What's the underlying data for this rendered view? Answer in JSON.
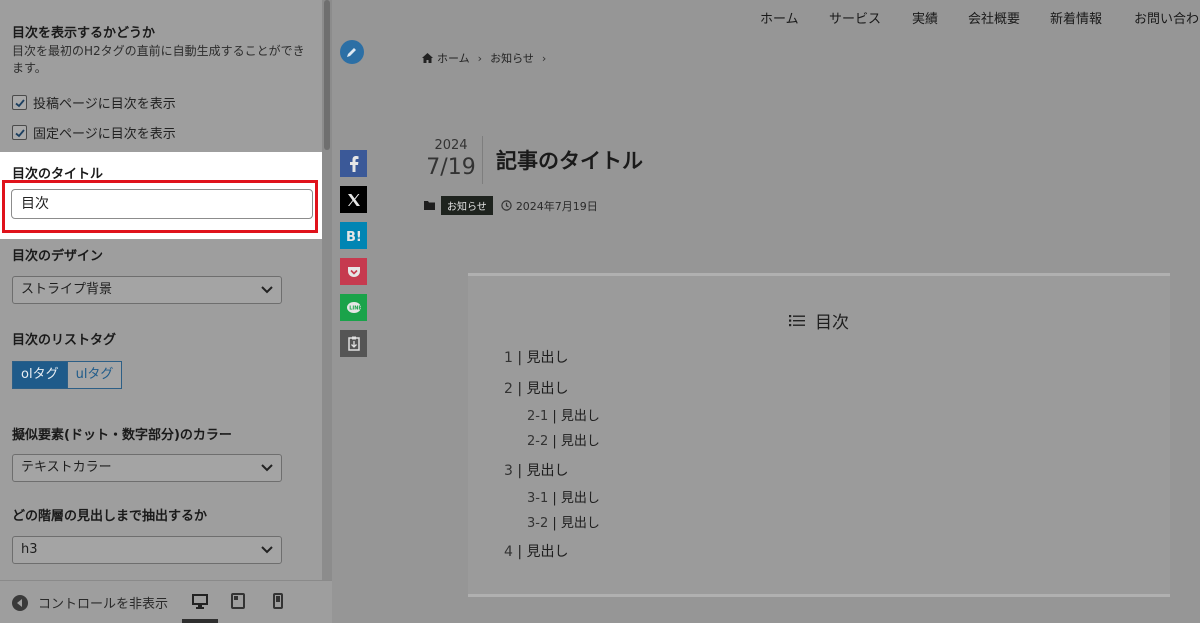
{
  "panel": {
    "toc_display": {
      "title": "目次を表示するかどうか",
      "description": "目次を最初のH2タグの直前に自動生成することができます。",
      "options": [
        {
          "label": "投稿ページに目次を表示",
          "checked": true
        },
        {
          "label": "固定ページに目次を表示",
          "checked": true
        }
      ]
    },
    "toc_title": {
      "label": "目次のタイトル",
      "value": "目次"
    },
    "toc_design": {
      "label": "目次のデザイン",
      "selected": "ストライプ背景"
    },
    "toc_list_tag": {
      "label": "目次のリストタグ",
      "options": [
        "olタグ",
        "ulタグ"
      ],
      "active": "olタグ"
    },
    "pseudo_color": {
      "label": "擬似要素(ドット・数字部分)のカラー",
      "selected": "テキストカラー"
    },
    "heading_depth": {
      "label": "どの階層の見出しまで抽出するか",
      "selected": "h3"
    },
    "footer": {
      "hide_controls": "コントロールを非表示"
    }
  },
  "preview": {
    "nav": [
      "ホーム",
      "サービス",
      "実績",
      "会社概要",
      "新着情報",
      "お問い合わ"
    ],
    "breadcrumb": [
      "ホーム",
      "お知らせ"
    ],
    "date": {
      "year": "2024",
      "month_day": "7/19"
    },
    "title": "記事のタイトル",
    "category": "お知らせ",
    "published": "2024年7月19日",
    "toc": {
      "heading": "目次",
      "items": [
        {
          "num": "1",
          "text": "見出し",
          "children": []
        },
        {
          "num": "2",
          "text": "見出し",
          "children": [
            {
              "num": "2-1",
              "text": "見出し"
            },
            {
              "num": "2-2",
              "text": "見出し"
            }
          ]
        },
        {
          "num": "3",
          "text": "見出し",
          "children": [
            {
              "num": "3-1",
              "text": "見出し"
            },
            {
              "num": "3-2",
              "text": "見出し"
            }
          ]
        },
        {
          "num": "4",
          "text": "見出し",
          "children": []
        }
      ]
    }
  },
  "colors": {
    "highlight_frame": "#e0121b",
    "accent_blue": "#1f5b8a",
    "facebook": "#3b5998",
    "twitter_x": "#000000",
    "hatena": "#00a4de",
    "pocket": "#ef3f56",
    "line": "#06c755",
    "copy": "#555555"
  }
}
